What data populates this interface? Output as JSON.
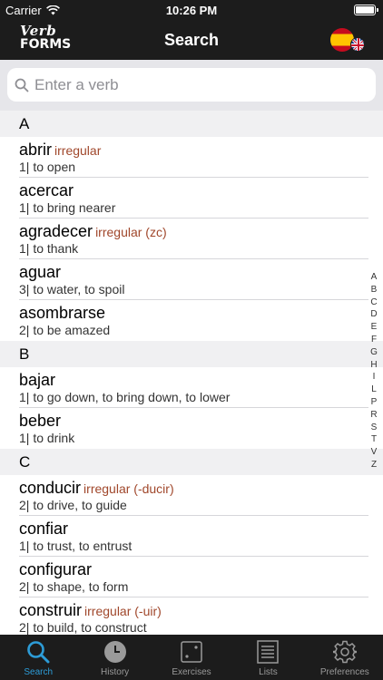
{
  "status_bar": {
    "carrier": "Carrier",
    "time": "10:26 PM"
  },
  "nav": {
    "logo_line1": "Verb",
    "logo_line2": "FORMS",
    "title": "Search",
    "language_icon": "spain-uk-flag-icon"
  },
  "search": {
    "placeholder": "Enter a verb",
    "value": ""
  },
  "sections": [
    {
      "letter": "A",
      "entries": [
        {
          "verb": "abrir",
          "tag": "irregular",
          "meaning": "1| to open"
        },
        {
          "verb": "acercar",
          "tag": "",
          "meaning": "1| to bring nearer"
        },
        {
          "verb": "agradecer",
          "tag": "irregular (zc)",
          "meaning": "1| to thank"
        },
        {
          "verb": "aguar",
          "tag": "",
          "meaning": "3| to water, to spoil"
        },
        {
          "verb": "asombrarse",
          "tag": "",
          "meaning": "2| to be amazed"
        }
      ]
    },
    {
      "letter": "B",
      "entries": [
        {
          "verb": "bajar",
          "tag": "",
          "meaning": "1| to go down, to bring down, to lower"
        },
        {
          "verb": "beber",
          "tag": "",
          "meaning": "1| to drink"
        }
      ]
    },
    {
      "letter": "C",
      "entries": [
        {
          "verb": "conducir",
          "tag": "irregular (-ducir)",
          "meaning": "2| to drive, to guide"
        },
        {
          "verb": "confiar",
          "tag": "",
          "meaning": "1| to trust, to entrust"
        },
        {
          "verb": "configurar",
          "tag": "",
          "meaning": "2| to shape, to form"
        },
        {
          "verb": "construir",
          "tag": "irregular (-uir)",
          "meaning": "2| to build, to construct"
        }
      ]
    }
  ],
  "index_letters": [
    "A",
    "B",
    "C",
    "D",
    "E",
    "F",
    "G",
    "H",
    "I",
    "L",
    "P",
    "R",
    "S",
    "T",
    "V",
    "Z"
  ],
  "tabs": [
    {
      "label": "Search",
      "icon": "search-icon",
      "active": true
    },
    {
      "label": "History",
      "icon": "clock-icon",
      "active": false
    },
    {
      "label": "Exercises",
      "icon": "dice-icon",
      "active": false
    },
    {
      "label": "Lists",
      "icon": "list-icon",
      "active": false
    },
    {
      "label": "Preferences",
      "icon": "gear-icon",
      "active": false
    }
  ],
  "colors": {
    "bar": "#1c1c1c",
    "accent": "#2d9cd7",
    "irregular": "#a0472b"
  }
}
